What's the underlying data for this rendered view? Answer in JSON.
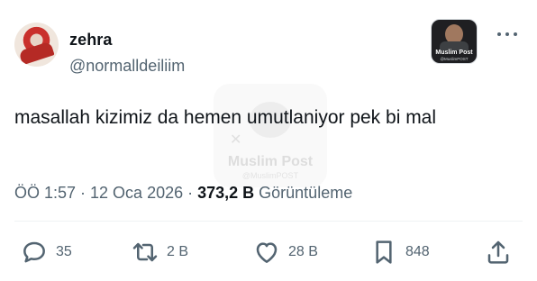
{
  "user": {
    "display_name": "zehra",
    "handle": "@normalldeiliim"
  },
  "brand": {
    "title": "Muslim Post",
    "handle": "@MuslimPOST"
  },
  "tweet": {
    "text": "masallah kizimiz da hemen umutlaniyor pek bi mal"
  },
  "meta": {
    "timestamp": "ÖÖ 1:57 · 12 Oca 2026 · ",
    "views_count": "373,2 B",
    "views_label": " Görüntüleme"
  },
  "actions": {
    "replies": "35",
    "reposts": "2 B",
    "likes": "28 B",
    "bookmarks": "848"
  },
  "icons": {
    "reply": "speech-bubble",
    "repost": "retweet-arrows",
    "like": "heart-outline",
    "bookmark": "bookmark-outline",
    "share": "share-upload",
    "more": "three-dots"
  },
  "colors": {
    "text": "#0f1419",
    "secondary": "#536471"
  }
}
